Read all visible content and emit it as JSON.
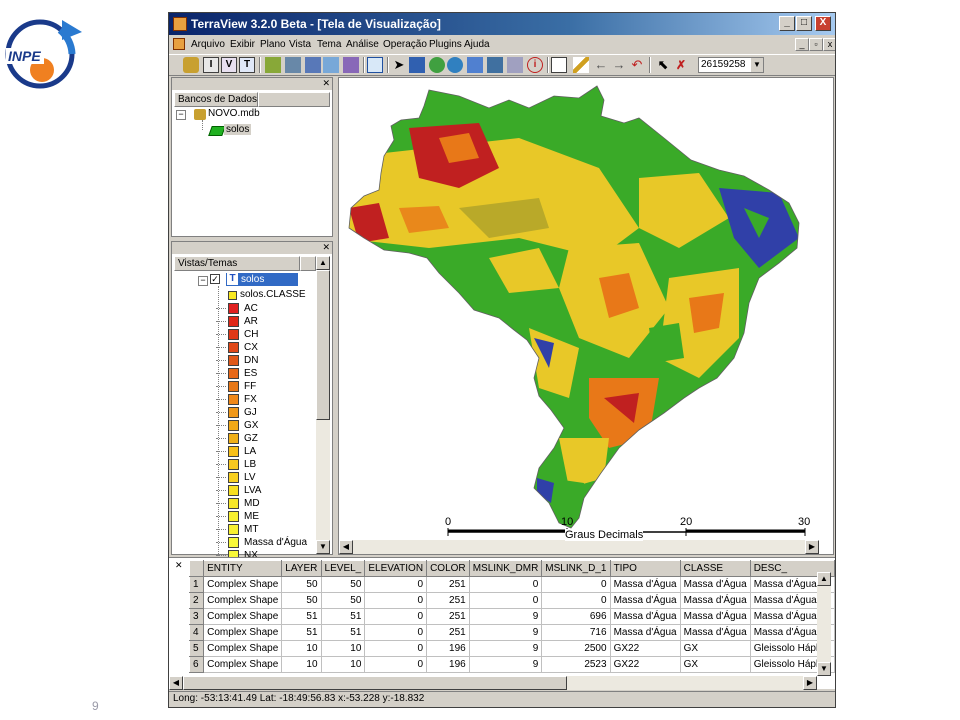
{
  "slide": {
    "page_number": "9"
  },
  "logo": {
    "text": "INPE"
  },
  "window": {
    "title": "TerraView 3.2.0 Beta - [Tela de Visualização]",
    "controls": [
      "_",
      "□",
      "X"
    ],
    "mdi_controls": [
      "_",
      "▫",
      "x"
    ]
  },
  "menu": {
    "items": [
      "Arquivo",
      "Exibir",
      "Plano",
      "Vista",
      "Tema",
      "Análise",
      "Operação",
      "Plugins",
      "Ajuda"
    ]
  },
  "toolbar": {
    "icons": [
      "database-icon",
      "info-icon",
      "view-icon",
      "theme-icon",
      "import-icon",
      "export-icon",
      "layer-icon",
      "query-icon",
      "chart-icon",
      "table-icon",
      "pointer-icon",
      "zoom-in-icon",
      "zoom-out-icon",
      "pan-icon",
      "box-icon",
      "print-icon",
      "info-cursor-icon",
      "edit-icon",
      "draw-icon",
      "back-arrow-icon",
      "forward-arrow-icon",
      "undo-icon",
      "select-icon",
      "delete-icon"
    ],
    "scale_value": "26159258"
  },
  "databases_panel": {
    "header": "Bancos de Dados",
    "db_name": "NOVO.mdb",
    "layer_name": "solos"
  },
  "views_panel": {
    "header": "Vistas/Temas",
    "theme_name": "solos",
    "legend_title": "solos.CLASSE",
    "legend": [
      {
        "label": "AC",
        "color": "#e02020"
      },
      {
        "label": "AR",
        "color": "#e02818"
      },
      {
        "label": "CH",
        "color": "#e03818"
      },
      {
        "label": "CX",
        "color": "#e04818"
      },
      {
        "label": "DN",
        "color": "#e05818"
      },
      {
        "label": "ES",
        "color": "#e86818"
      },
      {
        "label": "FF",
        "color": "#e87818"
      },
      {
        "label": "FX",
        "color": "#f08818"
      },
      {
        "label": "GJ",
        "color": "#f09818"
      },
      {
        "label": "GX",
        "color": "#f0a818"
      },
      {
        "label": "GZ",
        "color": "#f0b018"
      },
      {
        "label": "LA",
        "color": "#f8c018"
      },
      {
        "label": "LB",
        "color": "#f8c820"
      },
      {
        "label": "LV",
        "color": "#f8d020"
      },
      {
        "label": "LVA",
        "color": "#f8e020"
      },
      {
        "label": "MD",
        "color": "#f8e828"
      },
      {
        "label": "ME",
        "color": "#f8f030"
      },
      {
        "label": "MT",
        "color": "#f8f030"
      },
      {
        "label": "Massa d'Água",
        "color": "#f8f838"
      },
      {
        "label": "NX",
        "color": "#f8f838"
      }
    ]
  },
  "map": {
    "scalebar": {
      "ticks": [
        "0",
        "10",
        "20",
        "30"
      ],
      "unit": "Graus Decimals"
    },
    "colors": {
      "green": "#3aaa28",
      "yellow": "#e8c828",
      "orange": "#e87818",
      "red": "#c02020",
      "blue": "#3040a8",
      "olive": "#8a8a2a"
    }
  },
  "table": {
    "columns": [
      "ENTITY",
      "LAYER",
      "LEVEL_",
      "ELEVATION",
      "COLOR",
      "MSLINK_DMR",
      "MSLINK_D_1",
      "TIPO",
      "CLASSE",
      "DESC_"
    ],
    "rows": [
      [
        "1",
        "Complex Shape",
        "50",
        "50",
        "0",
        "251",
        "0",
        "0",
        "Massa d'Água",
        "Massa d'Água",
        "Massa d'Água"
      ],
      [
        "2",
        "Complex Shape",
        "50",
        "50",
        "0",
        "251",
        "0",
        "0",
        "Massa d'Água",
        "Massa d'Água",
        "Massa d'Água"
      ],
      [
        "3",
        "Complex Shape",
        "51",
        "51",
        "0",
        "251",
        "9",
        "696",
        "Massa d'Água",
        "Massa d'Água",
        "Massa d'Água"
      ],
      [
        "4",
        "Complex Shape",
        "51",
        "51",
        "0",
        "251",
        "9",
        "716",
        "Massa d'Água",
        "Massa d'Água",
        "Massa d'Água"
      ],
      [
        "5",
        "Complex Shape",
        "10",
        "10",
        "0",
        "196",
        "9",
        "2500",
        "GX22",
        "GX",
        "Gleissolo Háplico"
      ],
      [
        "6",
        "Complex Shape",
        "10",
        "10",
        "0",
        "196",
        "9",
        "2523",
        "GX22",
        "GX",
        "Gleissolo Háplico"
      ]
    ]
  },
  "status": {
    "text": "Long: -53:13:41.49 Lat: -18:49:56.83 x:-53.228 y:-18.832"
  }
}
